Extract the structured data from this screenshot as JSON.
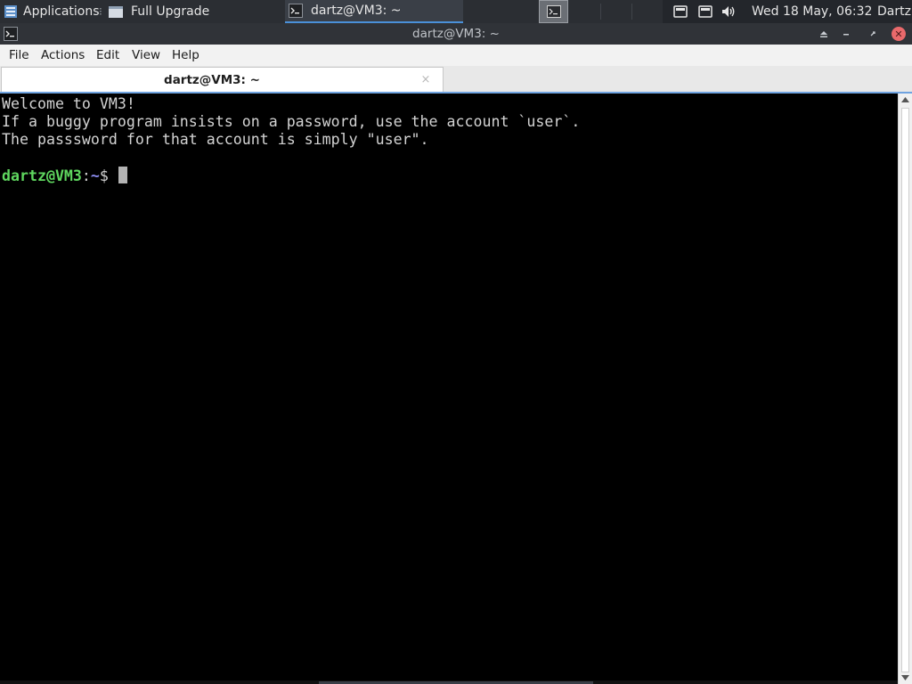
{
  "panel": {
    "applications_label": "Applications",
    "separator": "⁝",
    "tasks": [
      {
        "label": "Full Upgrade"
      },
      {
        "label": "dartz@VM3: ~"
      }
    ],
    "clock": "Wed 18 May, 06:32",
    "user": "Dartz"
  },
  "window": {
    "title": "dartz@VM3: ~",
    "close_glyph": "✕"
  },
  "menu": {
    "file": "File",
    "actions": "Actions",
    "edit": "Edit",
    "view": "View",
    "help": "Help"
  },
  "tab": {
    "label": "dartz@VM3: ~",
    "close_glyph": "×"
  },
  "terminal": {
    "lines": [
      "Welcome to VM3!",
      "If a buggy program insists on a password, use the account `user`.",
      "The passsword for that account is simply \"user\"."
    ],
    "prompt_user": "dartz@VM3",
    "prompt_colon": ":",
    "prompt_path": "~",
    "prompt_symbol": "$ "
  },
  "colors": {
    "prompt_user": "#5fd75f",
    "prompt_path": "#8c8cf0",
    "close_button": "#e9696b",
    "tab_accent": "#6fa3e0"
  }
}
